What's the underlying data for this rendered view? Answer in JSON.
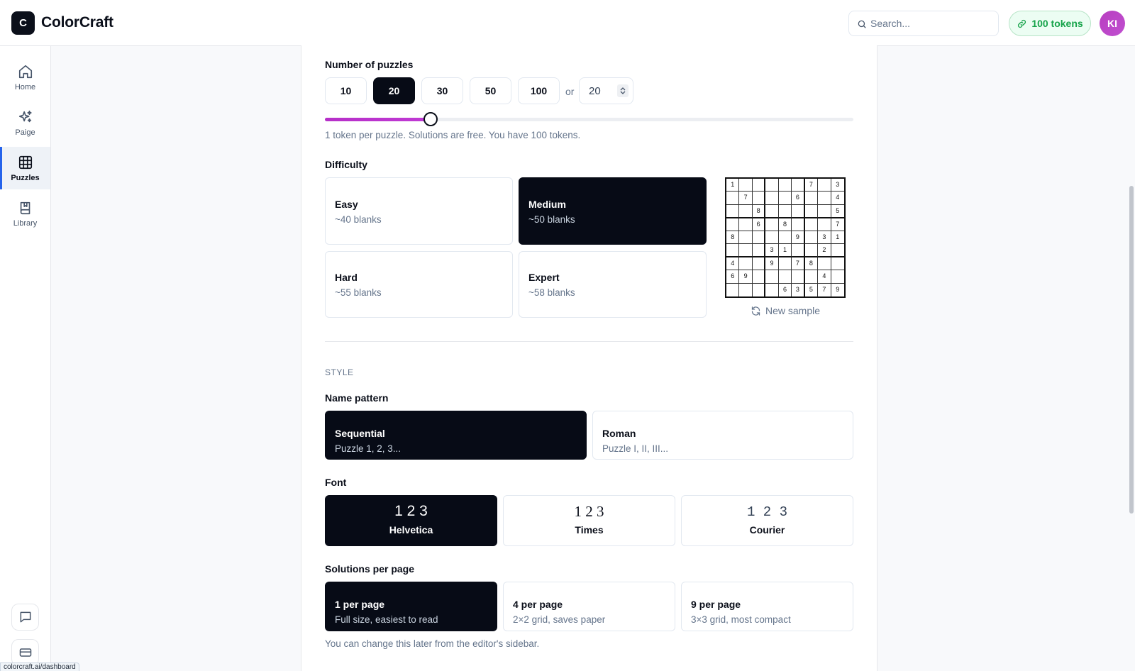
{
  "header": {
    "logo_letter": "C",
    "app_name": "ColorCraft",
    "search_placeholder": "Search...",
    "tokens_label": "100 tokens",
    "avatar_initials": "KI"
  },
  "sidebar": {
    "items": [
      {
        "label": "Home",
        "icon": "home-icon"
      },
      {
        "label": "Paige",
        "icon": "sparkles-icon"
      },
      {
        "label": "Puzzles",
        "icon": "grid-icon",
        "active": true
      },
      {
        "label": "Library",
        "icon": "book-icon"
      }
    ],
    "bottom_icons": [
      "chat-icon",
      "card-icon"
    ]
  },
  "status_url": "colorcraft.ai/dashboard",
  "puzzles": {
    "count_label": "Number of puzzles",
    "count_options": [
      "10",
      "20",
      "30",
      "50",
      "100"
    ],
    "count_selected": "20",
    "or_label": "or",
    "custom_value": "20",
    "slider_fraction": 0.2,
    "count_hint": "1 token per puzzle. Solutions are free. You have 100 tokens."
  },
  "difficulty": {
    "label": "Difficulty",
    "options": [
      {
        "title": "Easy",
        "sub": "~40 blanks"
      },
      {
        "title": "Medium",
        "sub": "~50 blanks",
        "selected": true
      },
      {
        "title": "Hard",
        "sub": "~55 blanks"
      },
      {
        "title": "Expert",
        "sub": "~58 blanks"
      }
    ],
    "sample_grid": [
      [
        "1",
        "",
        "",
        "",
        "",
        "",
        "7",
        "",
        "3"
      ],
      [
        "",
        "7",
        "",
        "",
        "",
        "6",
        "",
        "",
        "4"
      ],
      [
        "",
        "",
        "8",
        "",
        "",
        "",
        "",
        "",
        "5"
      ],
      [
        "",
        "",
        "6",
        "",
        "8",
        "",
        "",
        "",
        "7"
      ],
      [
        "8",
        "",
        "",
        "",
        "",
        "9",
        "",
        "3",
        "1"
      ],
      [
        "",
        "",
        "",
        "3",
        "1",
        "",
        "",
        "2",
        ""
      ],
      [
        "4",
        "",
        "",
        "9",
        "",
        "7",
        "8",
        "",
        ""
      ],
      [
        "6",
        "9",
        "",
        "",
        "",
        "",
        "",
        "4",
        ""
      ],
      [
        "",
        "",
        "",
        "",
        "6",
        "3",
        "5",
        "7",
        "9"
      ]
    ],
    "new_sample_label": "New sample"
  },
  "style": {
    "section_label": "STYLE",
    "name_pattern_label": "Name pattern",
    "name_patterns": [
      {
        "title": "Sequential",
        "sub": "Puzzle 1, 2, 3...",
        "selected": true
      },
      {
        "title": "Roman",
        "sub": "Puzzle I, II, III..."
      }
    ],
    "font_label": "Font",
    "fonts": [
      {
        "sample": "1 2 3",
        "name": "Helvetica",
        "selected": true
      },
      {
        "sample": "1 2 3",
        "name": "Times"
      },
      {
        "sample": "1  2  3",
        "name": "Courier"
      }
    ],
    "solutions_label": "Solutions per page",
    "solutions": [
      {
        "title": "1 per page",
        "sub": "Full size, easiest to read",
        "selected": true
      },
      {
        "title": "4 per page",
        "sub": "2×2 grid, saves paper"
      },
      {
        "title": "9 per page",
        "sub": "3×3 grid, most compact"
      }
    ],
    "solutions_hint": "You can change this later from the editor's sidebar."
  },
  "colors": {
    "selected_bg": "#070b16",
    "accent_purple": "#b62fc8",
    "token_green": "#16a34a",
    "active_nav_bar": "#2563eb"
  }
}
